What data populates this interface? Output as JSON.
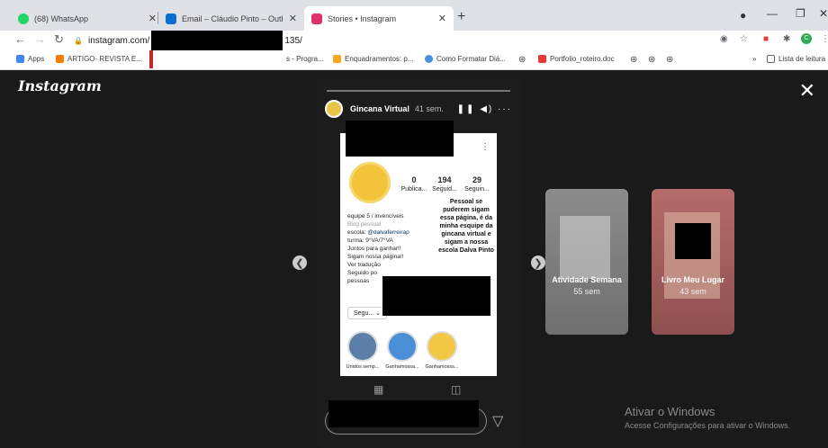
{
  "tabs": [
    {
      "label": "(68) WhatsApp",
      "color": "#25d366"
    },
    {
      "label": "Email – Cláudio Pinto – Outlook",
      "color": "#0a6ed1"
    },
    {
      "label": "Stories • Instagram",
      "color": "#e1306c"
    }
  ],
  "address": {
    "host": "instagram.com/",
    "path_end": "135/"
  },
  "bookmarks": [
    {
      "label": "Apps",
      "color": "#4285f4"
    },
    {
      "label": "ARTIGO- REVISTA E...",
      "color": "#f57c00"
    },
    {
      "label": "s - Progra...",
      "color": "#777777"
    },
    {
      "label": "Enquadramentos: p...",
      "color": "#f5a623"
    },
    {
      "label": "Como Formatar Diá...",
      "color": "#4a90e2"
    },
    {
      "label": "Portfolio_roteiro.doc",
      "color": "#e53935"
    },
    {
      "label": "Lista de leitura",
      "color": "#5f6368"
    }
  ],
  "instagram": {
    "logo": "Instagram"
  },
  "story": {
    "account": "Gincana Virtual",
    "time": "41 sem.",
    "profile": {
      "stats": [
        {
          "value": "0",
          "label": "Publica..."
        },
        {
          "value": "194",
          "label": "Seguid..."
        },
        {
          "value": "29",
          "label": "Seguin..."
        }
      ],
      "bio": {
        "line1": "equipe 5 / invencíveis",
        "line2": "Blog pessoal",
        "line3_prefix": "escola: ",
        "line3_link": "@dalvaferreirap",
        "line4": "turma: 9°VA/7°VA",
        "line5": "Juntos para ganhar!!",
        "line6": "Sigam nossa página!!",
        "line7": "Ver tradução",
        "line8": "Seguido po",
        "line9": "pessoas"
      },
      "overlay_text": "Pessoal se puderem sigam essa página, é da minha esquipe da gincana virtual e sigam a nossa escola Dalva Pinto",
      "follow_button": "Segu...",
      "highlights": [
        {
          "label": "Unidos semp..."
        },
        {
          "label": "Ganhamossa..."
        },
        {
          "label": "Ganhamosss..."
        }
      ]
    }
  },
  "side_stories": [
    {
      "title": "Atividade Semana",
      "time": "55 sem"
    },
    {
      "title": "Livro Meu Lugar",
      "time": "43 sem"
    }
  ],
  "watermark": {
    "title": "Ativar o Windows",
    "subtitle": "Acesse Configurações para ativar o Windows."
  }
}
